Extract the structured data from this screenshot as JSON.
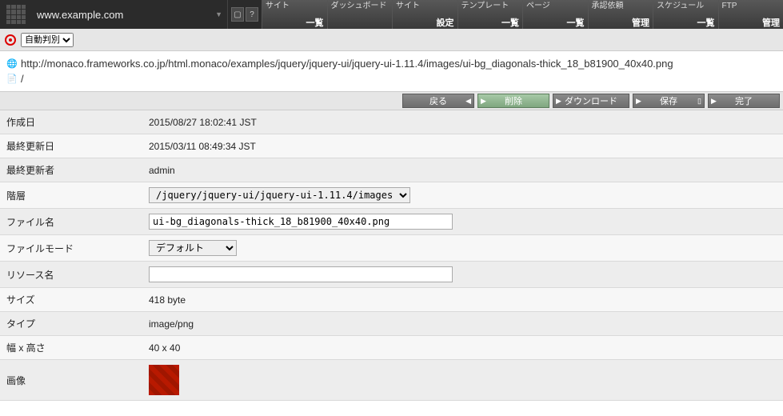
{
  "topbar": {
    "domain": "www.example.com",
    "nav": [
      {
        "top": "サイト",
        "bottom": "一覧"
      },
      {
        "top": "ダッシュボード",
        "bottom": ""
      },
      {
        "top": "サイト",
        "bottom": "設定"
      },
      {
        "top": "テンプレート",
        "bottom": "一覧"
      },
      {
        "top": "ページ",
        "bottom": "一覧"
      },
      {
        "top": "承認依頼",
        "bottom": "管理"
      },
      {
        "top": "スケジュール",
        "bottom": "一覧"
      },
      {
        "top": "FTP",
        "bottom": "管理"
      }
    ]
  },
  "secbar": {
    "encoding_option": "自動判別"
  },
  "paths": {
    "url": "http://monaco.frameworks.co.jp/html.monaco/examples/jquery/jquery-ui/jquery-ui-1.11.4/images/ui-bg_diagonals-thick_18_b81900_40x40.png",
    "slash": "/"
  },
  "actions": {
    "back": "戻る",
    "delete": "削除",
    "download": "ダウンロード",
    "save": "保存",
    "done": "完了"
  },
  "props": {
    "labels": {
      "created": "作成日",
      "updated": "最終更新日",
      "updater": "最終更新者",
      "hierarchy": "階層",
      "filename": "ファイル名",
      "filemode": "ファイルモード",
      "resname": "リソース名",
      "size": "サイズ",
      "type": "タイプ",
      "dims": "幅 x 高さ",
      "image": "画像"
    },
    "values": {
      "created": "2015/08/27 18:02:41 JST",
      "updated": "2015/03/11 08:49:34 JST",
      "updater": "admin",
      "hierarchy_option": "/jquery/jquery-ui/jquery-ui-1.11.4/images",
      "filename": "ui-bg_diagonals-thick_18_b81900_40x40.png",
      "filemode_option": "デフォルト",
      "resname": "",
      "size": "418 byte",
      "type": "image/png",
      "dims": "40 x 40"
    }
  }
}
